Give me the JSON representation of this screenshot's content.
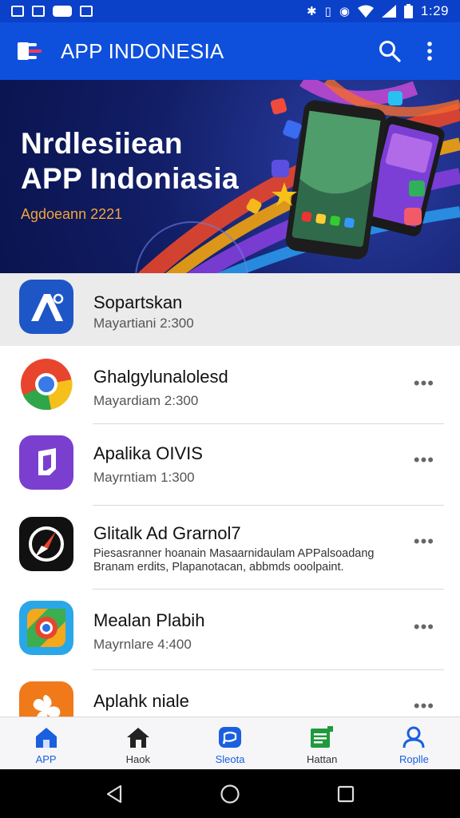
{
  "status_bar": {
    "time": "1:29",
    "left_icons": [
      "notification-square-icon",
      "image-icon",
      "messenger-icon",
      "app-notification-icon"
    ],
    "right_icons": [
      "bluetooth-icon",
      "vibrate-icon",
      "location-icon",
      "wifi-icon",
      "signal-icon",
      "battery-icon"
    ]
  },
  "app_bar": {
    "title": "APP INDONESIA",
    "actions": [
      "search-icon",
      "more-vertical-icon"
    ]
  },
  "banner": {
    "title_line1": "Nrdlesiiean",
    "title_line2": "APP Indoniasia",
    "subtitle": "Agdoeann 2221"
  },
  "apps": [
    {
      "title": "Sopartskan",
      "subtitle": "Mayartiani 2:300",
      "icon": "blue-a-logo-icon",
      "selected": true
    },
    {
      "title": "Ghalgylunalolesd",
      "subtitle": "Mayardiam 2:300",
      "icon": "chrome-style-icon"
    },
    {
      "title": "Apalika OIVIS",
      "subtitle": "Mayrntiam 1:300",
      "icon": "purple-music-note-icon"
    },
    {
      "title": "Glitalk Ad Grarnol7",
      "desc_line1": "Piesasranner hoanain Masaarnidaulam APPalsoadang",
      "desc_line2": "Branam erdits, Plapanotacan, abbmds ooolpaint.",
      "icon": "black-compass-arrow-icon"
    },
    {
      "title": "Mealan Plabih",
      "subtitle": "Mayrnlare 4:400",
      "icon": "map-style-icon"
    },
    {
      "title": "Aplahk niale",
      "subtitle": "",
      "icon": "orange-flower-icon"
    }
  ],
  "bottom_nav": [
    {
      "label": "APP",
      "icon": "home-filled-icon",
      "color": "#1a5fe0",
      "active": true
    },
    {
      "label": "Haok",
      "icon": "house-icon",
      "color": "#222222"
    },
    {
      "label": "Sleota",
      "icon": "chat-bubble-icon",
      "color": "#1a5fe0"
    },
    {
      "label": "Hattan",
      "icon": "document-list-icon",
      "color": "#1f9a3c"
    },
    {
      "label": "Roplle",
      "icon": "person-icon",
      "color": "#1a5fe0"
    }
  ],
  "colors": {
    "status_bar": "#0b40c8",
    "app_bar": "#0e50dc",
    "banner_subtitle": "#f3a33a",
    "selected_row": "#ebebeb"
  }
}
